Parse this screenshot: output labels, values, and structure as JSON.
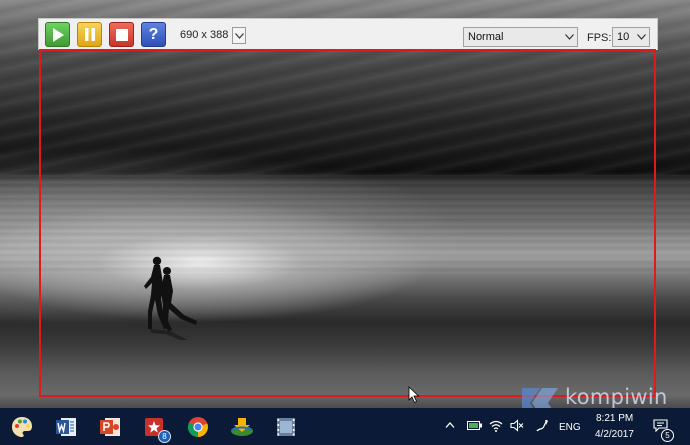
{
  "toolbar": {
    "buttons": [
      {
        "name": "play",
        "icon": "play-icon"
      },
      {
        "name": "pause",
        "icon": "pause-icon"
      },
      {
        "name": "stop",
        "icon": "stop-icon"
      },
      {
        "name": "help",
        "icon": "help-icon",
        "label": "?"
      }
    ],
    "capture_size": "690 x 388",
    "mode_value": "Normal",
    "fps_label": "FPS:",
    "fps_value": "10"
  },
  "taskbar": {
    "apps": [
      {
        "name": "paint",
        "icon": "paint-palette-icon"
      },
      {
        "name": "word",
        "icon": "word-icon"
      },
      {
        "name": "powerpoint",
        "icon": "powerpoint-icon"
      },
      {
        "name": "wps",
        "icon": "wps-icon",
        "badge": "8"
      },
      {
        "name": "chrome",
        "icon": "chrome-icon"
      },
      {
        "name": "idm",
        "icon": "download-manager-icon"
      },
      {
        "name": "video",
        "icon": "film-icon"
      }
    ],
    "tray": {
      "language": "ENG",
      "time": "8:21 PM",
      "date": "4/2/2017",
      "notifications": "5"
    }
  },
  "watermark": {
    "text": "kompiwin"
  },
  "colors": {
    "capture_border": "#e01a1a",
    "taskbar": "#0b1a36",
    "play": "#4cae3f",
    "pause": "#eab62a",
    "stop": "#d8443a",
    "help": "#3a5ccc"
  }
}
